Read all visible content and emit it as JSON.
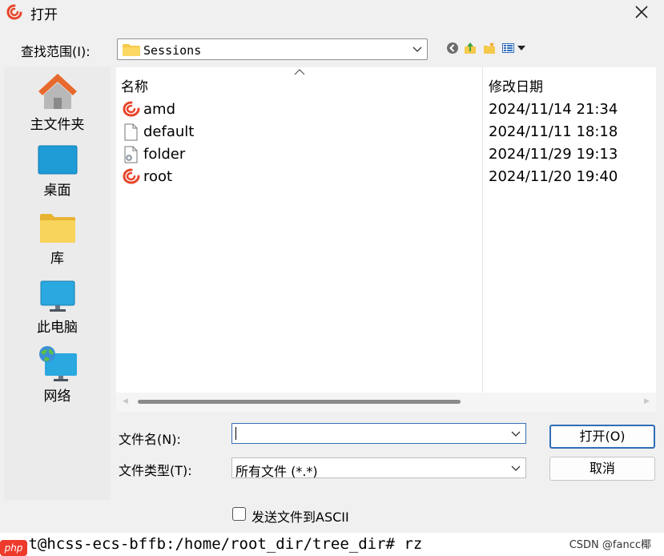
{
  "window": {
    "title": "打开"
  },
  "lookin": {
    "label": "查找范围(I):",
    "value": "Sessions"
  },
  "toolbar": {
    "icons": [
      "back-icon",
      "up-folder-icon",
      "new-folder-icon",
      "view-menu-icon"
    ]
  },
  "places": [
    {
      "label": "主文件夹",
      "icon": "home-icon"
    },
    {
      "label": "桌面",
      "icon": "desktop-icon"
    },
    {
      "label": "库",
      "icon": "library-folder-icon"
    },
    {
      "label": "此电脑",
      "icon": "computer-icon"
    },
    {
      "label": "网络",
      "icon": "network-icon"
    }
  ],
  "list": {
    "columns": {
      "name": "名称",
      "modified": "修改日期"
    },
    "rows": [
      {
        "name": "amd",
        "date": "2024/11/14 21:34",
        "icon": "session-icon"
      },
      {
        "name": "default",
        "date": "2024/11/11 18:18",
        "icon": "file-icon"
      },
      {
        "name": "folder",
        "date": "2024/11/29 19:13",
        "icon": "config-file-icon"
      },
      {
        "name": "root",
        "date": "2024/11/20 19:40",
        "icon": "session-icon"
      }
    ]
  },
  "filename": {
    "label": "文件名(N):",
    "value": ""
  },
  "filetype": {
    "label": "文件类型(T):",
    "value": "所有文件 (*.*)"
  },
  "buttons": {
    "open": "打开(O)",
    "cancel": "取消"
  },
  "ascii": {
    "label": "发送文件到ASCII",
    "checked": false
  },
  "terminal": {
    "text": "ot@hcss-ecs-bffb:/home/root_dir/tree_dir# rz",
    "badge": "php",
    "watermark": "CSDN @fancc椰"
  },
  "colors": {
    "accent": "#2f6db8",
    "session_red": "#e8452b",
    "folder_yellow": "#f6c94a"
  }
}
